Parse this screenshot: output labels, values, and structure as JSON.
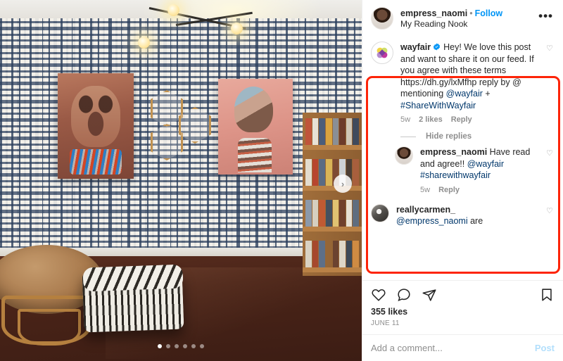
{
  "post": {
    "header": {
      "username": "empress_naomi",
      "separator": "•",
      "follow_label": "Follow",
      "location": "My Reading Nook",
      "more_label": "•••",
      "avatar_name": "empress-naomi-avatar"
    },
    "photo": {
      "alt": "Reading nook interior with papasan chair, patterned wallpaper and bookshelf",
      "next_arrow": "›",
      "carousel": {
        "total": 6,
        "active_index": 0
      }
    },
    "comments": [
      {
        "username": "wayfair",
        "verified": true,
        "text_plain": "Hey! We love this post and want to share it on our feed. If you agree with these terms https://dh.gy/lxMfhp reply by @ mentioning @wayfair + #ShareWithWayfair",
        "text_lead": "Hey! We love this post and want to share it on our feed. If you agree with these terms ",
        "url": "https://dh.gy/lxMfhp",
        "text_mid": " reply by @ mentioning ",
        "mention": "@wayfair",
        "text_plus": " + ",
        "hashtag": "#ShareWithWayfair",
        "time": "5w",
        "likes": "2 likes",
        "reply_label": "Reply",
        "like_icon": "♡"
      }
    ],
    "hide_replies_label": "Hide replies",
    "reply": {
      "username": "empress_naomi",
      "text_lead": " Have read and agree!! ",
      "mention": "@wayfair",
      "hashtag": "#sharewithwayfair",
      "time": "5w",
      "reply_label": "Reply",
      "like_icon": "♡"
    },
    "next_comment": {
      "username": "reallycarmen_",
      "mention": "@empress_naomi",
      "trailing_text": " are",
      "like_icon": "♡"
    },
    "actions": {
      "like_icon": "heart-icon",
      "comment_icon": "comment-icon",
      "share_icon": "share-icon",
      "save_icon": "bookmark-icon"
    },
    "likes_count": "355 likes",
    "date": "JUNE 11",
    "add_comment": {
      "placeholder": "Add a comment...",
      "value": "",
      "post_label": "Post"
    }
  },
  "colors": {
    "accent_blue": "#0095f6",
    "link_blue": "#00376b",
    "highlight_red": "#fd2408",
    "text_primary": "#262626",
    "text_secondary": "#8e8e8e"
  }
}
